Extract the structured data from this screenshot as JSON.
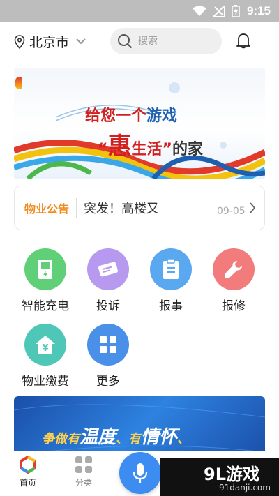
{
  "status_bar": {
    "time": "9:15"
  },
  "header": {
    "city": "北京市",
    "search_placeholder": "搜索"
  },
  "banner": {
    "line1_a": "给您一",
    "line1_b": "个",
    "line1_c": "游戏",
    "line2_a": "“",
    "line2_b": "惠",
    "line2_c": "生活”",
    "line2_d": "的家"
  },
  "notice": {
    "tag": "物业公告",
    "text": "突发！高楼又",
    "date": "09-05"
  },
  "services": [
    {
      "label": "智能充电",
      "color": "#5fcf78",
      "icon": "charging-pile-icon"
    },
    {
      "label": "投诉",
      "color": "#b79af0",
      "icon": "ticket-icon"
    },
    {
      "label": "报事",
      "color": "#5aa8f0",
      "icon": "clipboard-icon"
    },
    {
      "label": "报修",
      "color": "#f27b7b",
      "icon": "wrench-icon"
    },
    {
      "label": "物业缴费",
      "color": "#4fc7b6",
      "icon": "house-yen-icon"
    },
    {
      "label": "更多",
      "color": "#4a8fe8",
      "icon": "grid-more-icon"
    }
  ],
  "banner2": {
    "slogan_a": "争做有",
    "slogan_b": "温度",
    "slogan_c": "、有",
    "slogan_d": "情怀",
    "slogan_e": "、"
  },
  "tabbar": {
    "home": "首页",
    "category": "分类"
  },
  "watermark": {
    "big": "9L游戏",
    "small": "91danji.com"
  }
}
